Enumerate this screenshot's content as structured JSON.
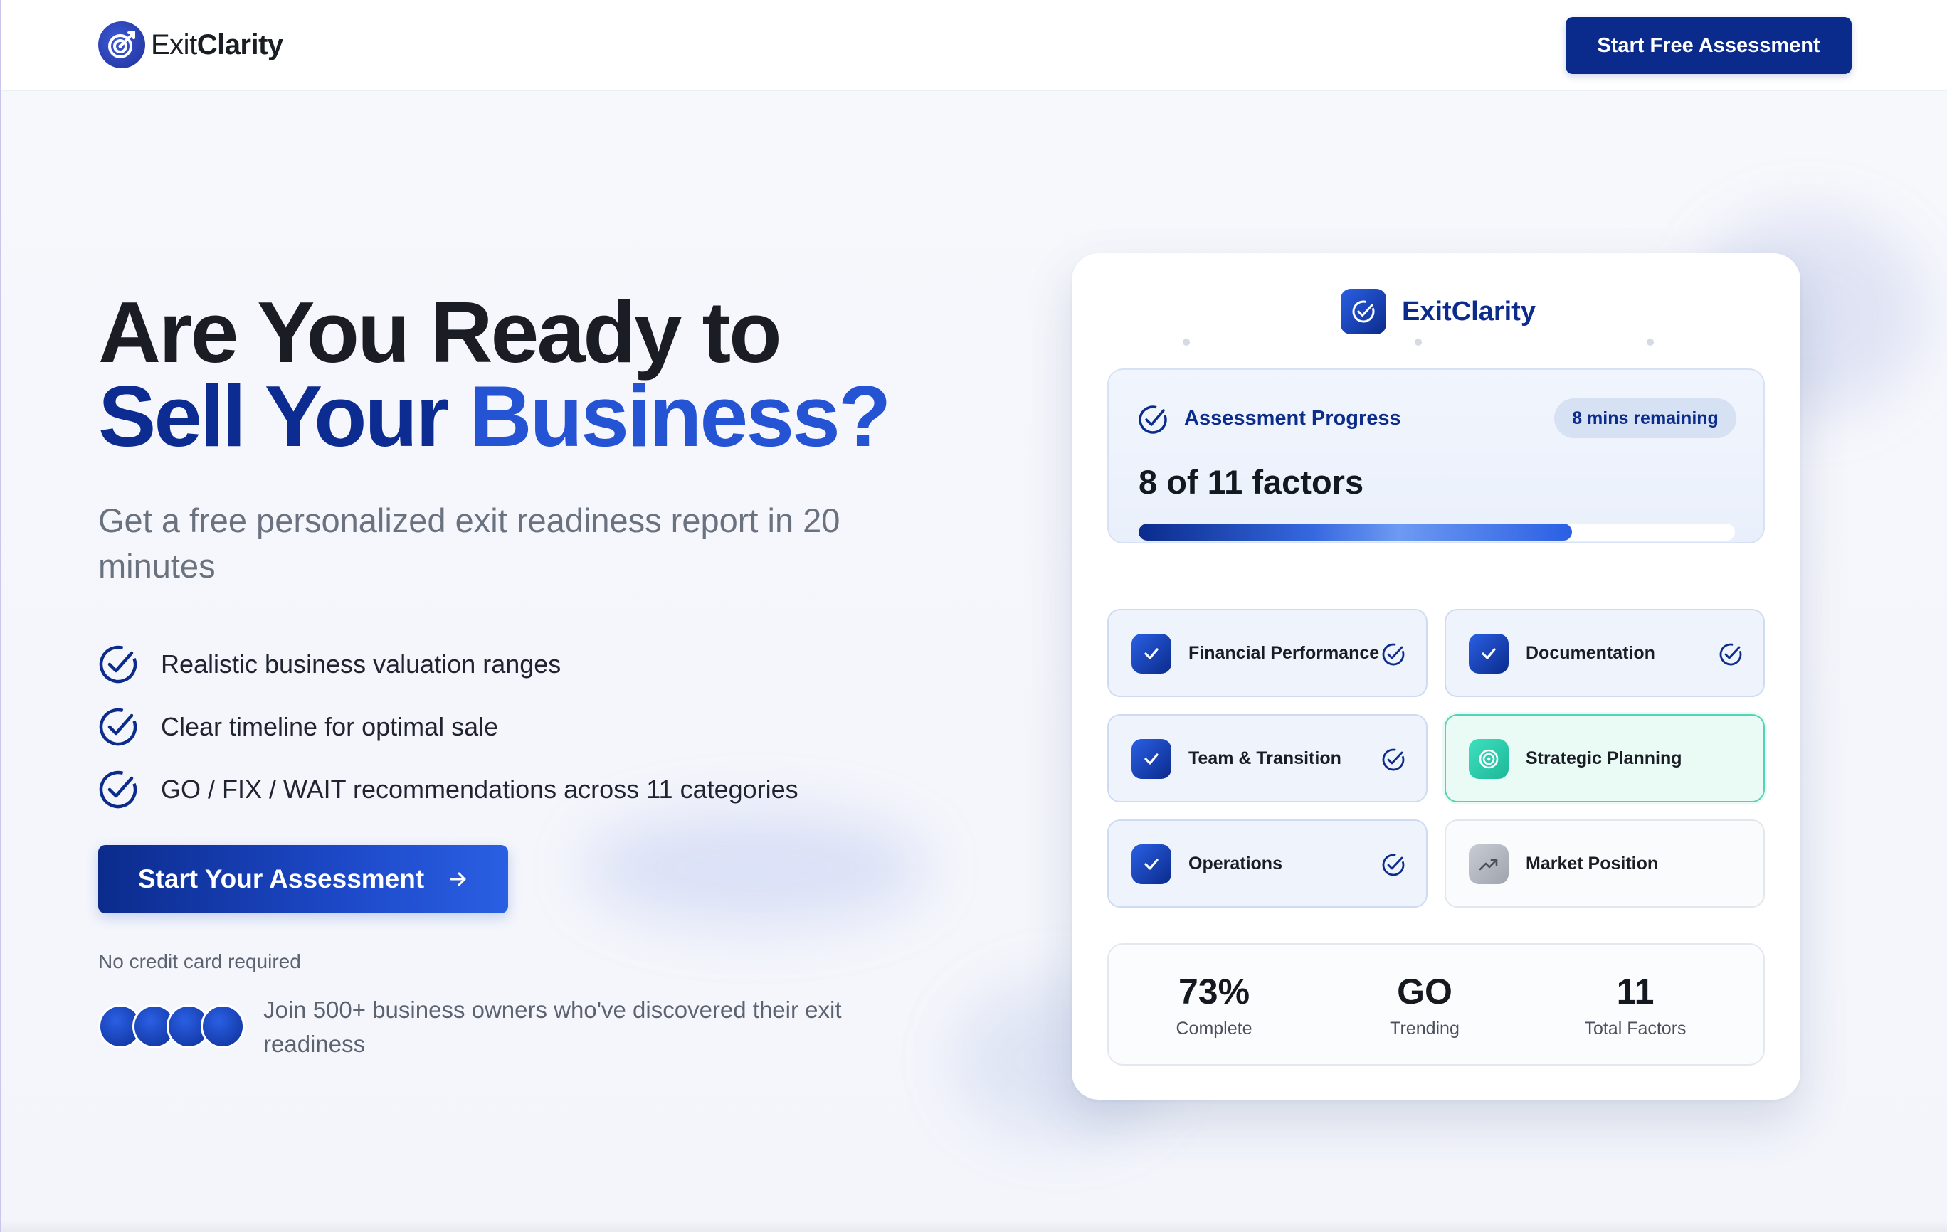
{
  "header": {
    "brand_prefix": "Exit",
    "brand_suffix": "Clarity",
    "cta_label": "Start Free Assessment"
  },
  "hero": {
    "title_line1": "Are You Ready to",
    "title_line2_a": "Sell Your",
    "title_line2_b": "Business?",
    "subtitle": "Get a free personalized exit readiness report in 20 minutes",
    "features": [
      "Realistic business valuation ranges",
      "Clear timeline for optimal sale",
      "GO / FIX / WAIT recommendations across 11 categories"
    ],
    "cta_label": "Start Your Assessment",
    "cta_icon": "arrow-right-icon",
    "note": "No credit card required",
    "social_proof": "Join 500+ business owners who've discovered their exit readiness"
  },
  "card": {
    "brand": "ExitClarity",
    "progress": {
      "title": "Assessment Progress",
      "badge": "8 mins remaining",
      "count_text": "8 of 11 factors",
      "fraction": 0.727
    },
    "factors": [
      {
        "label": "Financial Performance",
        "status": "complete",
        "icon": "check-icon"
      },
      {
        "label": "Documentation",
        "status": "complete",
        "icon": "check-icon"
      },
      {
        "label": "Team & Transition",
        "status": "complete",
        "icon": "check-icon"
      },
      {
        "label": "Strategic Planning",
        "status": "active",
        "icon": "target-icon"
      },
      {
        "label": "Operations",
        "status": "complete",
        "icon": "check-icon"
      },
      {
        "label": "Market Position",
        "status": "pending",
        "icon": "trend-up-icon"
      }
    ],
    "stats": [
      {
        "value": "73%",
        "label": "Complete"
      },
      {
        "value": "GO",
        "label": "Trending"
      },
      {
        "value": "11",
        "label": "Total Factors"
      }
    ]
  },
  "colors": {
    "brand_navy": "#0b2b8c",
    "brand_blue": "#2454d4",
    "active_teal": "#52d3b3"
  }
}
